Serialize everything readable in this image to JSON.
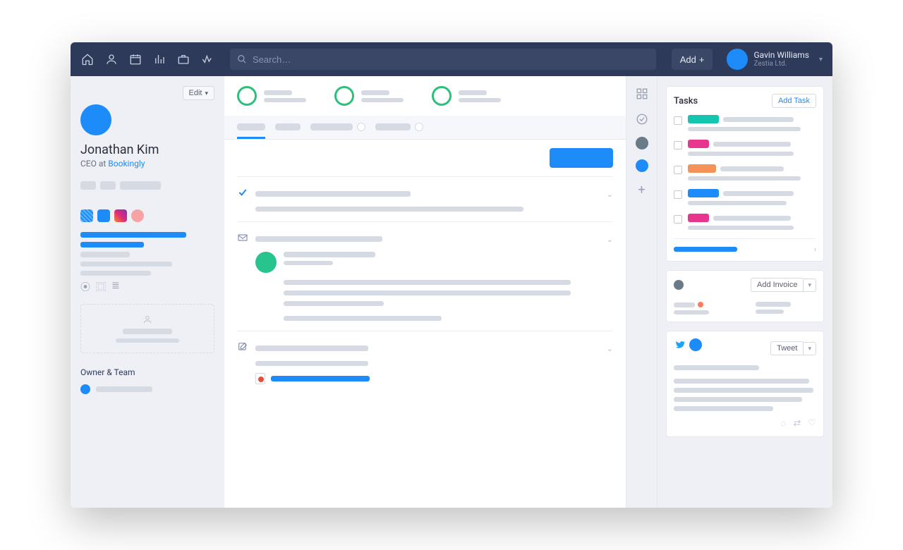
{
  "topbar": {
    "search_placeholder": "Search…",
    "add_label": "Add",
    "user_name": "Gavin Williams",
    "user_org": "Zestia Ltd."
  },
  "contact": {
    "name": "Jonathan Kim",
    "role_prefix": "CEO at ",
    "company": "Bookingly",
    "edit_label": "Edit"
  },
  "left": {
    "owner_section": "Owner & Team"
  },
  "right": {
    "tasks_title": "Tasks",
    "add_task": "Add Task",
    "add_invoice": "Add Invoice",
    "tweet_btn": "Tweet"
  },
  "colors": {
    "blue": "#1d8cf8",
    "green": "#28c48e",
    "magenta": "#e8368f",
    "orange": "#f5925a",
    "teal": "#14c6b0",
    "slate": "#6b7a89"
  }
}
